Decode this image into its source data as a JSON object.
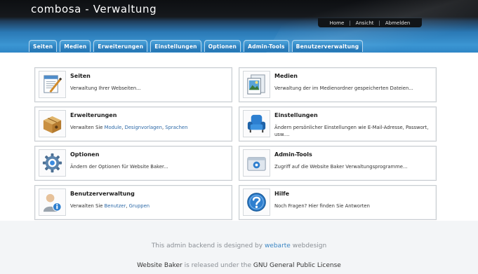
{
  "header": {
    "site_title": "combosa - Verwaltung"
  },
  "topnav": {
    "items": [
      "Home",
      "Ansicht",
      "Abmelden"
    ],
    "separator": "|"
  },
  "tabs": [
    "Seiten",
    "Medien",
    "Erweiterungen",
    "Einstellungen",
    "Optionen",
    "Admin-Tools",
    "Benutzerverwaltung"
  ],
  "cards": {
    "seiten": {
      "title": "Seiten",
      "desc": "Verwaltung Ihrer Webseiten...",
      "icon": "pages-icon"
    },
    "medien": {
      "title": "Medien",
      "desc": "Verwaltung der im Medienordner gespeicherten Dateien...",
      "icon": "media-icon"
    },
    "erweiterungen": {
      "title": "Erweiterungen",
      "desc_prefix": "Verwalten Sie ",
      "links": [
        "Module",
        "Designvorlagen",
        "Sprachen"
      ],
      "sep1": ", ",
      "sep2": ", ",
      "icon": "addons-box-icon"
    },
    "einstellungen": {
      "title": "Einstellungen",
      "desc": "Ändern persönlicher Einstellungen wie E-Mail-Adresse, Passwort, usw....",
      "icon": "armchair-icon"
    },
    "optionen": {
      "title": "Optionen",
      "desc": "Ändern der Optionen für Website Baker...",
      "icon": "gear-icon"
    },
    "admintools": {
      "title": "Admin-Tools",
      "desc": "Zugriff auf die Website Baker Verwaltungsprogramme...",
      "icon": "admin-tools-icon"
    },
    "benutzer": {
      "title": "Benutzerverwaltung",
      "desc_prefix": "Verwalten Sie ",
      "links": [
        "Benutzer",
        "Gruppen"
      ],
      "sep1": ", ",
      "icon": "user-info-icon"
    },
    "hilfe": {
      "title": "Hilfe",
      "desc": "Noch Fragen? Hier finden Sie Antworten",
      "icon": "help-icon"
    }
  },
  "footer": {
    "line1_prefix": "This admin backend is designed by ",
    "line1_link": "webarte",
    "line1_suffix": " webdesign",
    "line2_product": "Website Baker",
    "line2_mid": " is released under the ",
    "line2_license": "GNU General Public License"
  },
  "colors": {
    "accent": "#2e83c1",
    "link": "#2e6aa8",
    "footer_link": "#3b86c4"
  }
}
